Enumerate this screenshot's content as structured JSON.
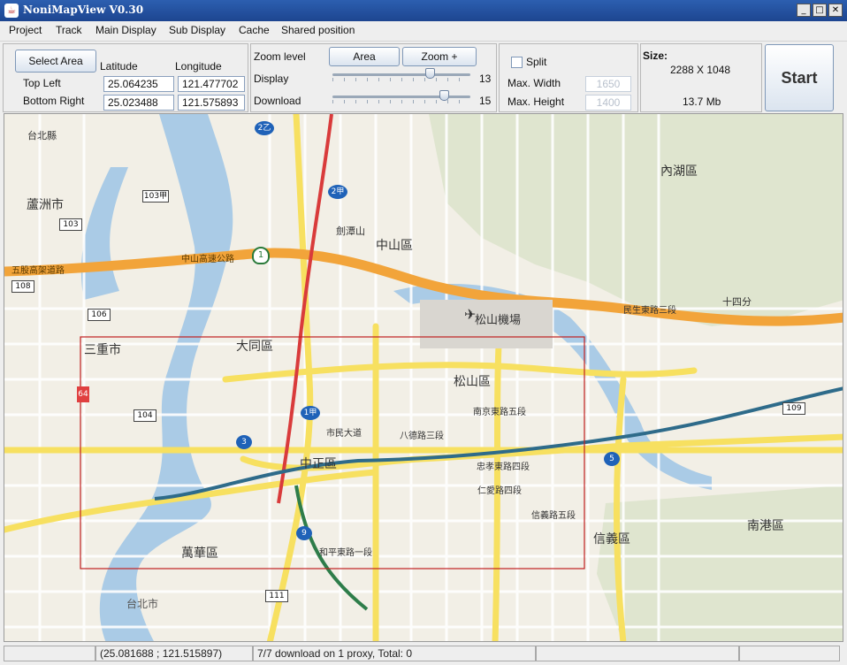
{
  "window": {
    "title": "NoniMapView V0.30",
    "app_icon": "java-cup-icon",
    "controls": {
      "minimize": "_",
      "maximize": "□",
      "close": "✕"
    }
  },
  "menu": {
    "items": [
      "Project",
      "Track",
      "Main Display",
      "Sub Display",
      "Cache",
      "Shared position"
    ]
  },
  "area_panel": {
    "select_area_label": "Select Area",
    "latitude_header": "Latitude",
    "longitude_header": "Longitude",
    "top_left_label": "Top Left",
    "bottom_right_label": "Bottom Right",
    "top_left_lat": "25.064235",
    "top_left_lon": "121.477702",
    "bottom_right_lat": "25.023488",
    "bottom_right_lon": "121.575893"
  },
  "zoom_panel": {
    "zoom_level_label": "Zoom level",
    "area_button": "Area",
    "zoom_plus_button": "Zoom +",
    "display_label": "Display",
    "display_value": "13",
    "download_label": "Download",
    "download_value": "15",
    "slider_min": 0,
    "slider_max": 18
  },
  "split_panel": {
    "split_label": "Split",
    "split_checked": false,
    "max_width_label": "Max. Width",
    "max_width_value": "1650",
    "max_height_label": "Max. Height",
    "max_height_value": "1400"
  },
  "size_panel": {
    "size_label": "Size:",
    "dimensions": "2288 X 1048",
    "file_size": "13.7 Mb"
  },
  "start_button": "Start",
  "map": {
    "labels": {
      "sanchong": "三重市",
      "datong": "大同區",
      "songshan": "松山區",
      "zhongzheng": "中正區",
      "wanhua": "萬華區",
      "xinyi": "信義區",
      "nangang": "南港區",
      "neihu": "內湖區",
      "zhongshan": "中山區",
      "luzhou": "蘆洲市",
      "airport": "松山機場",
      "jiantan": "劍潭山",
      "shijian": "十四分",
      "taipei_county": "台北縣",
      "taipei_city": "台北市"
    },
    "road_labels": {
      "zhongshan_hwy": "中山高速公路",
      "wugu_hwy": "五股高架道路",
      "civic_blvd": "市民大道",
      "zhongxiao": "忠孝東路四段",
      "renai": "仁愛路四段",
      "xinyi_road": "信義路五段",
      "nanjing": "南京東路五段",
      "minsheng": "民生東路三段",
      "bade": "八德路三段",
      "heping": "和平東路一段"
    },
    "route_badges": [
      "1",
      "2乙",
      "2甲",
      "1甲",
      "3",
      "5",
      "9",
      "64",
      "103",
      "103甲",
      "104",
      "106",
      "108",
      "109",
      "111"
    ],
    "selection_rect_color": "#c02020"
  },
  "status": {
    "coordinates": "(25.081688 ; 121.515897)",
    "download_info": "7/7 download on 1 proxy, Total: 0"
  }
}
